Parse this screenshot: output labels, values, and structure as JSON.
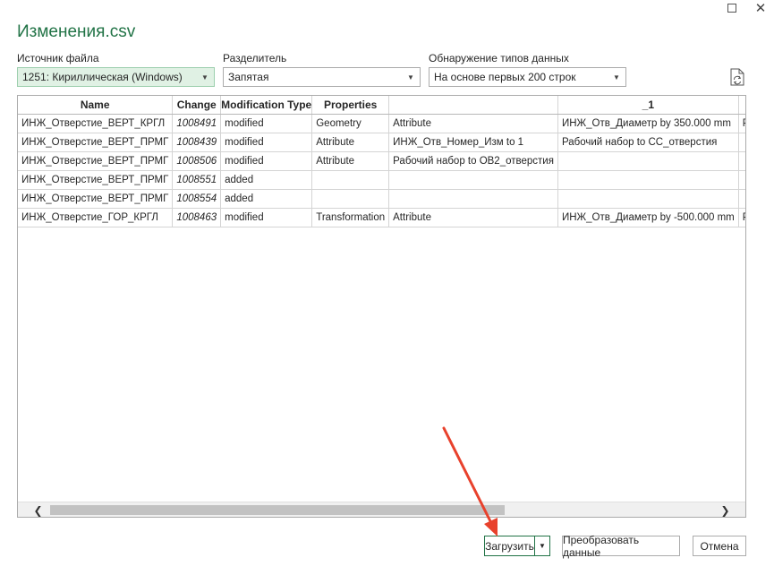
{
  "window": {
    "title": "Изменения.csv"
  },
  "controls": {
    "file_origin": {
      "label": "Источник файла",
      "value": "1251: Кириллическая (Windows)"
    },
    "delimiter": {
      "label": "Разделитель",
      "value": "Запятая"
    },
    "type_detection": {
      "label": "Обнаружение типов данных",
      "value": "На основе первых 200 строк"
    }
  },
  "table": {
    "columns": [
      "Name",
      "Change",
      "Modification Type",
      "Properties",
      "",
      "_1",
      ""
    ],
    "rows": [
      [
        "ИНЖ_Отверстие_ВЕРТ_КРГЛ",
        "1008491",
        "modified",
        "Geometry",
        "Attribute",
        "ИНЖ_Отв_Диаметр by 350.000 mm",
        "Рад"
      ],
      [
        "ИНЖ_Отверстие_ВЕРТ_ПРМГ",
        "1008439",
        "modified",
        "Attribute",
        "ИНЖ_Отв_Номер_Изм to 1",
        "Рабочий набор to СС_отверстия",
        ""
      ],
      [
        "ИНЖ_Отверстие_ВЕРТ_ПРМГ",
        "1008506",
        "modified",
        "Attribute",
        "Рабочий набор to ОВ2_отверстия",
        "",
        ""
      ],
      [
        "ИНЖ_Отверстие_ВЕРТ_ПРМГ",
        "1008551",
        "added",
        "",
        "",
        "",
        ""
      ],
      [
        "ИНЖ_Отверстие_ВЕРТ_ПРМГ",
        "1008554",
        "added",
        "",
        "",
        "",
        ""
      ],
      [
        "ИНЖ_Отверстие_ГОР_КРГЛ",
        "1008463",
        "modified",
        "Transformation",
        "Attribute",
        "ИНЖ_Отв_Диаметр by -500.000 mm",
        "Рад"
      ]
    ]
  },
  "buttons": {
    "load": "Загрузить",
    "transform": "Преобразовать данные",
    "cancel": "Отмена"
  },
  "colors": {
    "accent": "#217346",
    "selected_bg": "#e0f1e4",
    "annotation_arrow": "#e8412c"
  },
  "icons": {
    "maximize": "maximize-icon",
    "close": "close-icon",
    "refresh": "refresh-icon",
    "dropdown": "chevron-down-icon"
  }
}
